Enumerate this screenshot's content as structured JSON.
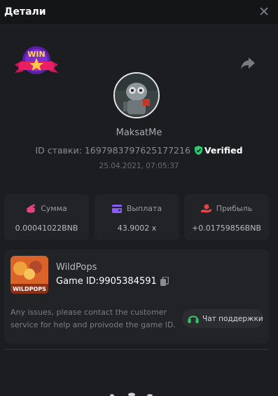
{
  "header": {
    "title": "Детали"
  },
  "bet": {
    "username": "MaksatMe",
    "id_label": "ID ставки:",
    "id_value": "1697983797625177216",
    "verified_label": "Verified",
    "datetime": "25.04.2021, 07:05:37"
  },
  "badge": {
    "text": "WIN"
  },
  "stats": [
    {
      "label": "Сумма",
      "value": "0.00041022BNB",
      "icon": "coins-icon",
      "color": "#e0457b"
    },
    {
      "label": "Выплата",
      "value": "43.9002 x",
      "icon": "wallet-icon",
      "color": "#8a5cf5"
    },
    {
      "label": "Прибыль",
      "value": "+0.01759856BNB",
      "icon": "profit-hand-icon",
      "color": "#e8434b"
    }
  ],
  "game": {
    "name": "WildPops",
    "id_label": "Game ID:",
    "id_value": "9905384591",
    "thumb_text": "WILDPOPS",
    "issue_text": "Any issues, please contact the customer service for help and proivode the game ID.",
    "support_label": "Чат поддержки"
  },
  "colors": {
    "verified": "#2ecc71",
    "support_icon": "#37c76b",
    "background": "#1c1d21",
    "card": "#222327"
  }
}
